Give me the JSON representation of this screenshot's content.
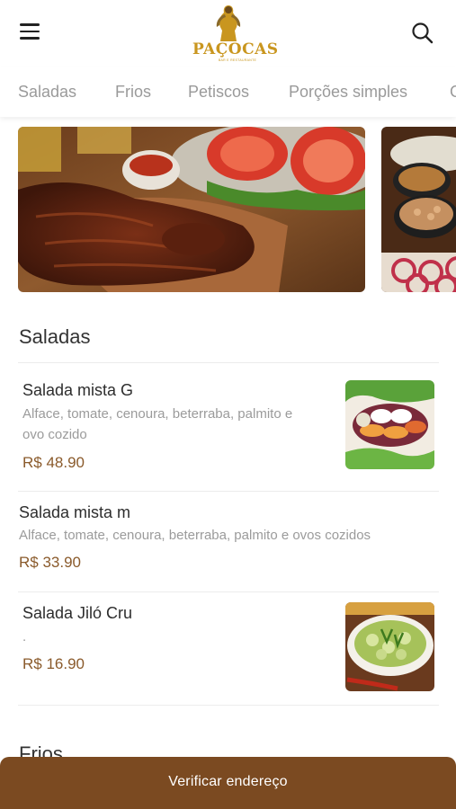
{
  "header": {
    "logo_text": "PAÇOCAS",
    "logo_subtext": "BAR E RESTAURANTE"
  },
  "tabs": [
    "Saladas",
    "Frios",
    "Petiscos",
    "Porções simples",
    "G"
  ],
  "sections": [
    {
      "title": "Saladas",
      "items": [
        {
          "name": "Salada mista G",
          "description_line1": "Alface, tomate, cenoura, beterraba, palmito e",
          "description_line2": "ovo cozido",
          "price": "R$ 48.90"
        },
        {
          "name": "Salada mista m",
          "description_line1": "Alface, tomate, cenoura, beterraba, palmito e ovos cozidos",
          "price": "R$ 33.90"
        },
        {
          "name": "Salada Jiló Cru",
          "description_line1": ".",
          "price": "R$ 16.90"
        }
      ]
    },
    {
      "title": "Frios"
    }
  ],
  "footer": {
    "label": "Verificar endereço"
  },
  "colors": {
    "brand_brown": "#7b4a21",
    "price": "#8a5a2b",
    "logo_gold": "#c9961f"
  }
}
